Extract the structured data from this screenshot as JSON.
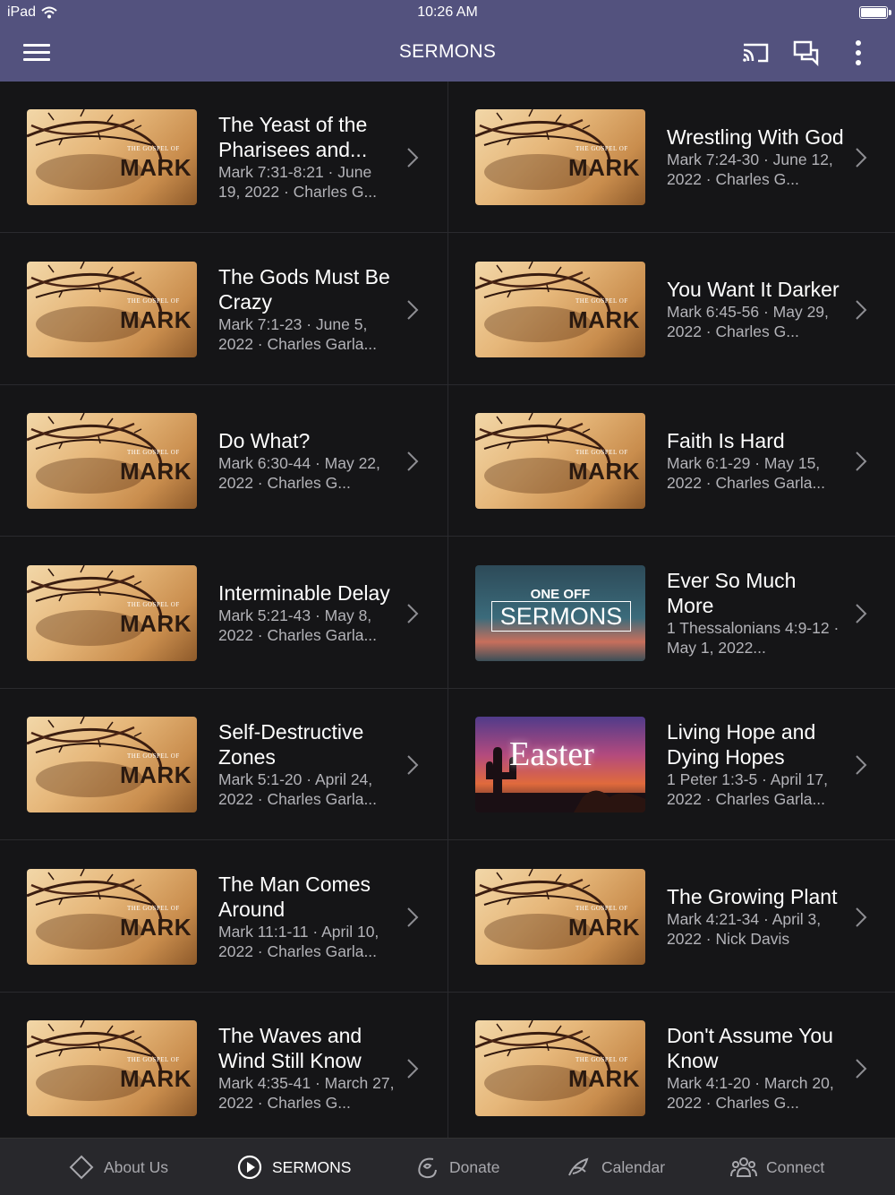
{
  "status_bar": {
    "device": "iPad",
    "time": "10:26 AM"
  },
  "header": {
    "title": "SERMONS"
  },
  "sermons": [
    {
      "title": "The Yeast of the Pharisees and...",
      "meta": "Mark 7:31-8:21 · June 19, 2022 · Charles G...",
      "thumb": "mark"
    },
    {
      "title": "Wrestling With God",
      "meta": "Mark 7:24-30 · June 12, 2022 · Charles G...",
      "thumb": "mark"
    },
    {
      "title": "The Gods Must Be Crazy",
      "meta": "Mark 7:1-23 · June 5, 2022 · Charles Garla...",
      "thumb": "mark"
    },
    {
      "title": "You Want It Darker",
      "meta": "Mark 6:45-56 · May 29, 2022 · Charles G...",
      "thumb": "mark"
    },
    {
      "title": "Do What?",
      "meta": "Mark 6:30-44 · May 22, 2022 · Charles G...",
      "thumb": "mark"
    },
    {
      "title": "Faith Is Hard",
      "meta": "Mark 6:1-29 · May 15, 2022 · Charles Garla...",
      "thumb": "mark"
    },
    {
      "title": "Interminable Delay",
      "meta": "Mark 5:21-43 · May 8, 2022 · Charles Garla...",
      "thumb": "mark"
    },
    {
      "title": "Ever So Much More",
      "meta": "1 Thessalonians 4:9-12 · May 1, 2022...",
      "thumb": "oneoff"
    },
    {
      "title": "Self-Destructive Zones",
      "meta": "Mark 5:1-20 · April 24, 2022 · Charles Garla...",
      "thumb": "mark"
    },
    {
      "title": "Living Hope and Dying Hopes",
      "meta": "1 Peter 1:3-5 · April 17, 2022 · Charles Garla...",
      "thumb": "easter"
    },
    {
      "title": "The Man Comes Around",
      "meta": "Mark 11:1-11 · April 10, 2022 · Charles Garla...",
      "thumb": "mark"
    },
    {
      "title": "The Growing Plant",
      "meta": "Mark 4:21-34 · April 3, 2022 · Nick Davis",
      "thumb": "mark"
    },
    {
      "title": "The Waves and Wind Still Know",
      "meta": "Mark 4:35-41 · March 27, 2022 · Charles G...",
      "thumb": "mark"
    },
    {
      "title": "Don't Assume You Know",
      "meta": "Mark 4:1-20 · March 20, 2022 · Charles G...",
      "thumb": "mark"
    }
  ],
  "thumb_text": {
    "mark_prefix": "THE GOSPEL OF",
    "mark_word": "MARK",
    "oneoff_top": "ONE OFF",
    "oneoff_main": "SERMONS",
    "easter": "Easter"
  },
  "tabs": [
    {
      "label": "About Us",
      "icon": "diamond-icon",
      "active": false
    },
    {
      "label": "SERMONS",
      "icon": "play-circle-icon",
      "active": true
    },
    {
      "label": "Donate",
      "icon": "donate-icon",
      "active": false
    },
    {
      "label": "Calendar",
      "icon": "calendar-icon",
      "active": false
    },
    {
      "label": "Connect",
      "icon": "people-icon",
      "active": false
    }
  ],
  "colors": {
    "header_bg": "#53527e",
    "page_bg": "#151517",
    "tabbar_bg": "#28282c",
    "meta_text": "#b3b3b8"
  }
}
